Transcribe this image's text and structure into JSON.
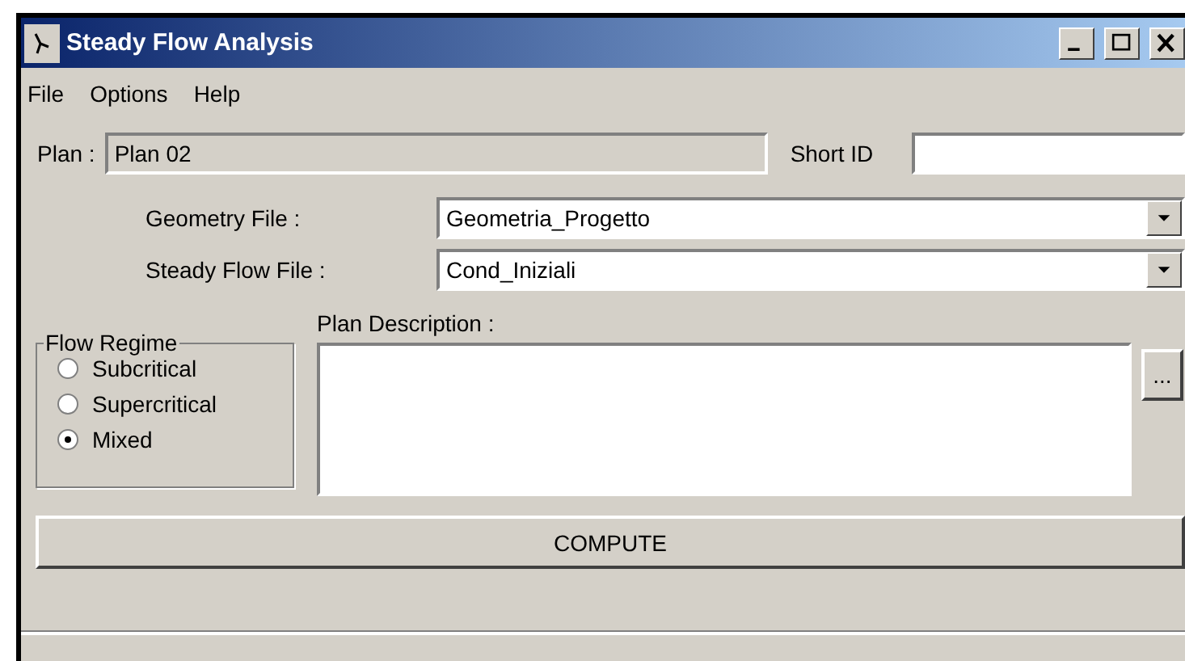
{
  "window": {
    "title": "Steady Flow Analysis"
  },
  "menu": [
    "File",
    "Options",
    "Help"
  ],
  "plan": {
    "label": "Plan :",
    "value": "Plan 02"
  },
  "short_id": {
    "label": "Short ID"
  },
  "files": [
    {
      "label": "Geometry File :",
      "value": "Geometria_Progetto"
    },
    {
      "label": "Steady Flow File :",
      "value": "Cond_Iniziali"
    }
  ],
  "flow_regime": {
    "title": "Flow Regime",
    "options": [
      {
        "label": "Subcritical",
        "selected": false
      },
      {
        "label": "Supercritical",
        "selected": false
      },
      {
        "label": "Mixed",
        "selected": true
      }
    ]
  },
  "description": {
    "label": "Plan Description :",
    "browse": "..."
  },
  "compute_button": "COMPUTE"
}
